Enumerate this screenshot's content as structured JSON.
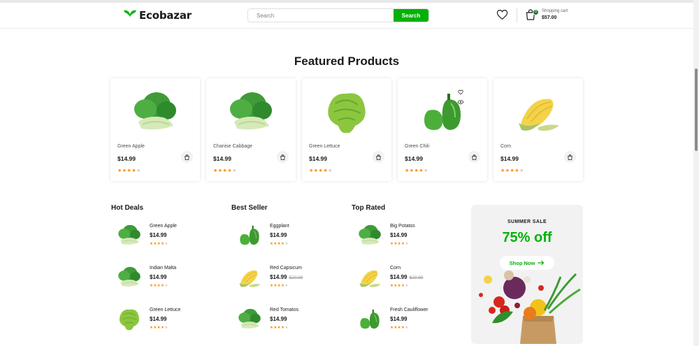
{
  "header": {
    "brand": "Ecobazar",
    "search_placeholder": "Search",
    "search_button": "Search",
    "cart_label": "Shopping cart:",
    "cart_total": "$57.00",
    "cart_count": "0"
  },
  "featured": {
    "title": "Featured Products",
    "products": [
      {
        "name": "Green Apple",
        "price": "$14.99",
        "rating": 4,
        "image": "bok-choy"
      },
      {
        "name": "Chanise Cabbage",
        "price": "$14.99",
        "rating": 4,
        "image": "bok-choy"
      },
      {
        "name": "Green Lettuce",
        "price": "$14.99",
        "rating": 4,
        "image": "lettuce"
      },
      {
        "name": "Green Chili",
        "price": "$14.99",
        "rating": 4,
        "image": "green-pepper"
      },
      {
        "name": "Corn",
        "price": "$14.99",
        "rating": 4,
        "image": "corn"
      }
    ]
  },
  "hot_deals": {
    "title": "Hot Deals",
    "items": [
      {
        "name": "Green Apple",
        "price": "$14.99",
        "old_price": "",
        "rating": 4,
        "image": "bok-choy"
      },
      {
        "name": "Indian Malta",
        "price": "$14.99",
        "old_price": "",
        "rating": 4,
        "image": "bok-choy"
      },
      {
        "name": "Green Lettuce",
        "price": "$14.99",
        "old_price": "",
        "rating": 4,
        "image": "lettuce"
      }
    ]
  },
  "best_seller": {
    "title": "Best Seller",
    "items": [
      {
        "name": "Eggplant",
        "price": "$14.99",
        "old_price": "",
        "rating": 4,
        "image": "green-pepper"
      },
      {
        "name": "Red Capsicum",
        "price": "$14.99",
        "old_price": "$20.99",
        "rating": 4,
        "image": "corn"
      },
      {
        "name": "Red Tomatos",
        "price": "$14.99",
        "old_price": "",
        "rating": 4,
        "image": "bok-choy"
      }
    ]
  },
  "top_rated": {
    "title": "Top Rated",
    "items": [
      {
        "name": "Big Potatos",
        "price": "$14.99",
        "old_price": "",
        "rating": 4,
        "image": "bok-choy"
      },
      {
        "name": "Corn",
        "price": "$14.99",
        "old_price": "$20.99",
        "rating": 4,
        "image": "corn"
      },
      {
        "name": "Fresh Cauliflower",
        "price": "$14.99",
        "old_price": "",
        "rating": 4,
        "image": "green-pepper"
      }
    ]
  },
  "banner": {
    "tag": "SUMMER SALE",
    "discount": "75% off",
    "button": "Shop Now"
  },
  "colors": {
    "brand_green": "#00b207",
    "dark_green": "#2c742f",
    "star": "#ff8a00"
  }
}
